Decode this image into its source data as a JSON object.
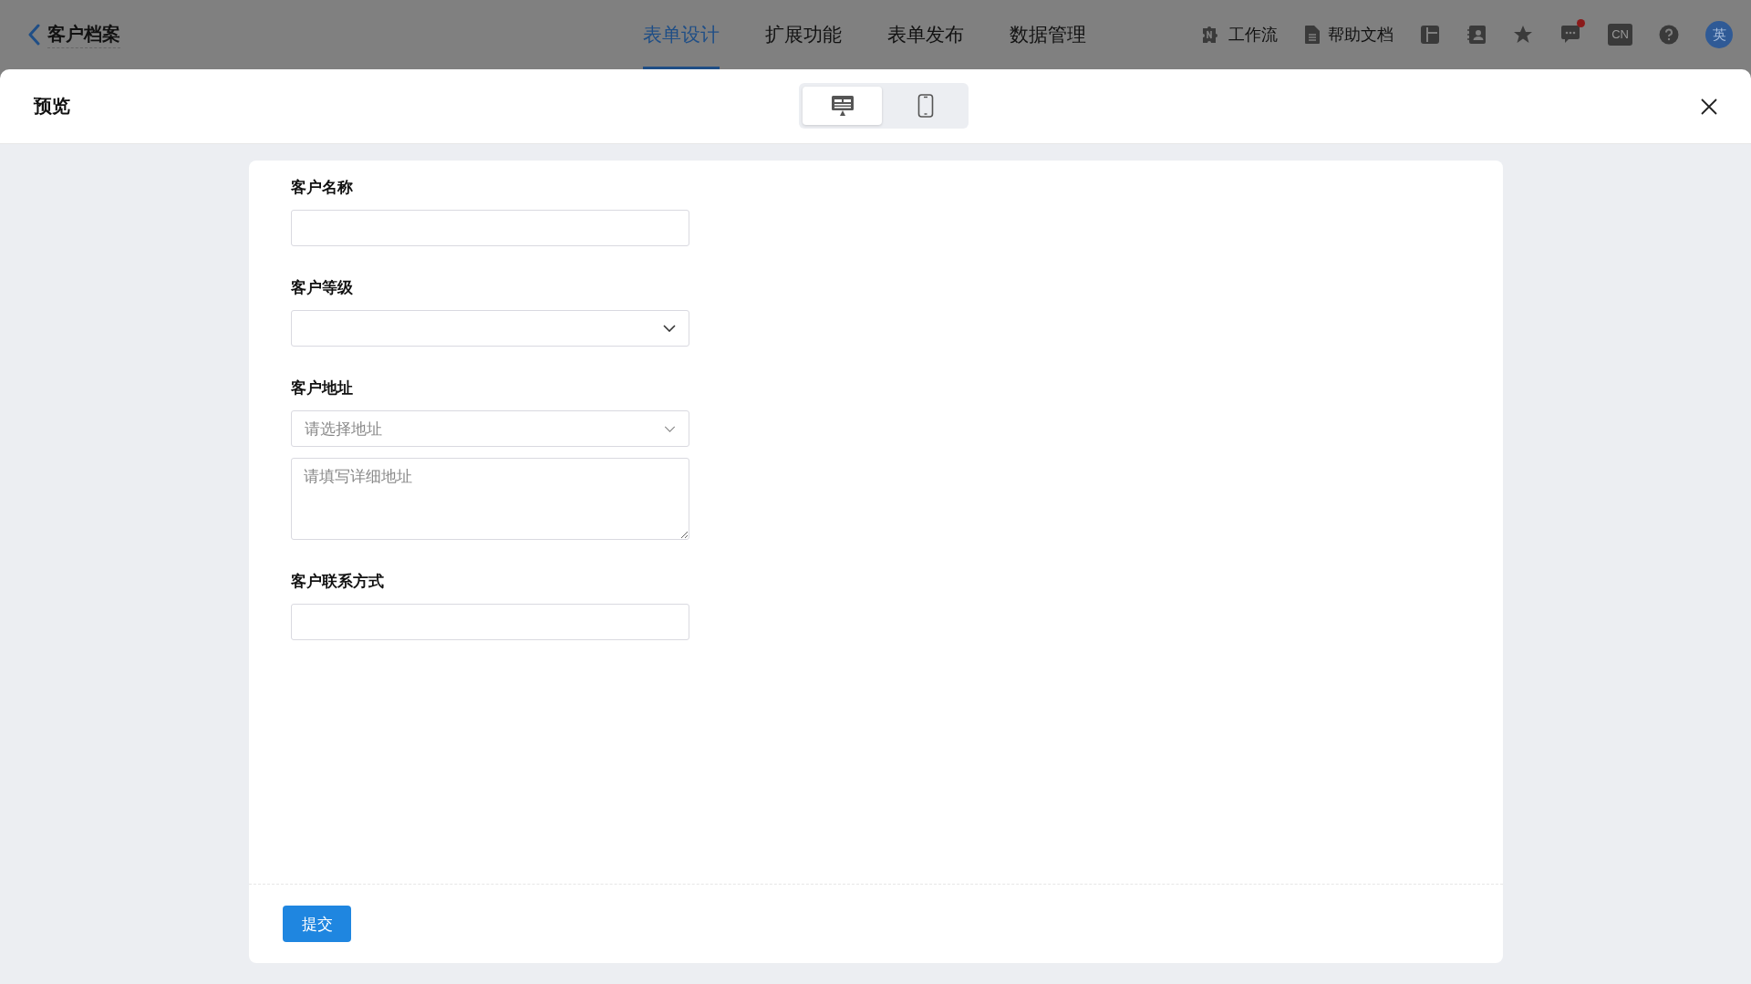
{
  "app_bar": {
    "title": "客户档案",
    "tabs": [
      {
        "label": "表单设计",
        "selected": true
      },
      {
        "label": "扩展功能",
        "selected": false
      },
      {
        "label": "表单发布",
        "selected": false
      },
      {
        "label": "数据管理",
        "selected": false
      }
    ],
    "tools": [
      {
        "kind": "workflow",
        "label": "工作流"
      },
      {
        "kind": "document",
        "label": "帮助文档"
      },
      {
        "kind": "layout"
      },
      {
        "kind": "contacts"
      },
      {
        "kind": "star"
      },
      {
        "kind": "messages",
        "unread": true
      },
      {
        "kind": "language",
        "label": "CN"
      },
      {
        "kind": "help"
      }
    ],
    "avatar": "英"
  },
  "preview": {
    "title": "预览",
    "devices": [
      {
        "kind": "desktop",
        "selected": true
      },
      {
        "kind": "mobile",
        "selected": false
      }
    ]
  },
  "form": {
    "fields": [
      {
        "kind": "text",
        "label": "客户名称"
      },
      {
        "kind": "select",
        "label": "客户等级"
      },
      {
        "kind": "address",
        "label": "客户地址",
        "placeholder": "请选择地址",
        "detail_placeholder": "请填写详细地址"
      },
      {
        "kind": "text",
        "label": "客户联系方式"
      }
    ],
    "submit": "提交"
  }
}
